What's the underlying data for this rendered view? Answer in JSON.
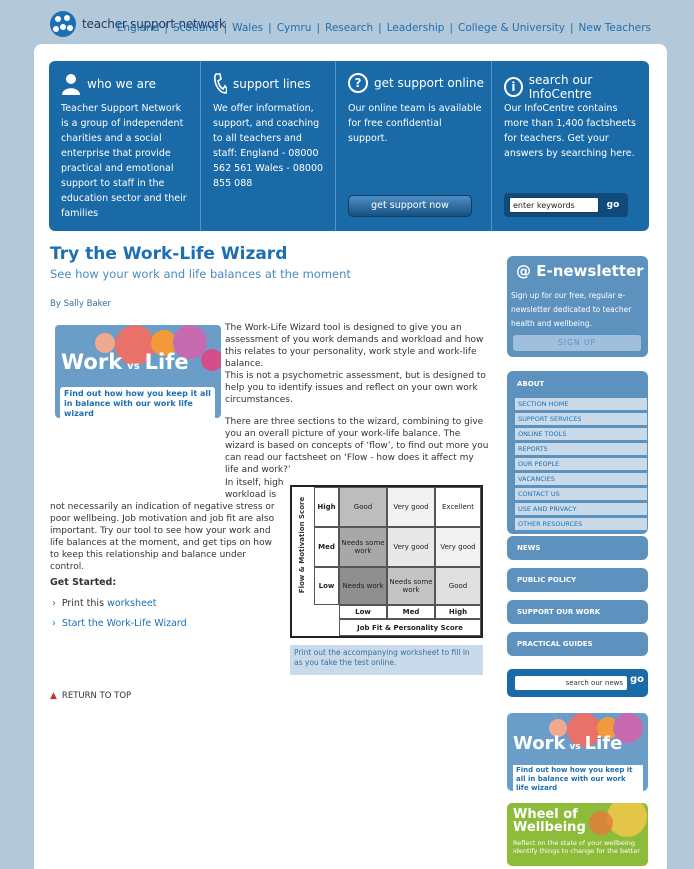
{
  "site": {
    "logo_text": "teacher support network"
  },
  "topnav": [
    "England",
    "Scotland",
    "Wales",
    "Cymru",
    "Research",
    "Leadership",
    "College & University",
    "New Teachers"
  ],
  "banner": {
    "who": {
      "title": "who we are",
      "text": "Teacher Support Network is a group of independent charities and a social enterprise that provide practical and emotional support to staff in the education sector and their families"
    },
    "lines": {
      "title": "support lines",
      "text": "We offer information, support, and coaching to all teachers and staff: England - 08000 562 561 Wales - 08000 855 088"
    },
    "online": {
      "title": "get support online",
      "text": "Our online team is available for free confidential support.",
      "button": "get support now"
    },
    "info": {
      "title": "search our InfoCentre",
      "text": "Our InfoCentre contains more than 1,400 factsheets for teachers. Get your answers by searching here.",
      "search_placeholder": "enter keywords",
      "go": "go"
    }
  },
  "article": {
    "title": "Try the Work-Life Wizard",
    "subtitle": "See how your work and life balances at the moment",
    "byline": "By Sally Baker",
    "hero": {
      "work": "Work",
      "vs": "vs",
      "life": "Life",
      "tagline": "Find out how how you keep it all in balance with our work life wizard"
    },
    "p1": "The Work-Life Wizard tool is designed to give you an assessment of you work demands and workload and how this relates to your personality, work style and work-life balance.",
    "p2": "This is not a psychometric assessment, but is designed to help you to identify issues and reflect on your own work circumstances.",
    "p3": "There are three sections to the wizard, combining to give you an overall picture of your work-life balance. The wizard is based on concepts of ‘flow’, to find out more you can read our factsheet on ‘Flow - how does it affect my life and work?’",
    "p4a": "In itself, high workload is",
    "p4b": "not necessarily an indication of negative stress or poor wellbeing. Job motivation and job fit are also important. Try our tool to see how your work and life balances at the moment, and get tips on how to keep this relationship and balance under control.",
    "get_started": "Get Started:",
    "link1_pre": "Print this ",
    "link1": "worksheet",
    "link2": "Start the Work-Life Wizard",
    "return_top": "RETURN TO TOP"
  },
  "matrix": {
    "y_axis": "Flow & Motivation Score",
    "x_axis": "Job Fit & Personality Score",
    "rows": [
      "High",
      "Med",
      "Low"
    ],
    "cols": [
      "Low",
      "Med",
      "High"
    ],
    "cells": [
      [
        "Good",
        "Very good",
        "Excellent"
      ],
      [
        "Needs some work",
        "Very good",
        "Very good"
      ],
      [
        "Needs work",
        "Needs some work",
        "Good"
      ]
    ],
    "caption": "Print out the accompanying worksheet to fill in as you take the test online."
  },
  "sidebar": {
    "enews": {
      "title": "@ E-newsletter",
      "text": "Sign up for our free, regular e-newsletter dedicated to teacher health and wellbeing.",
      "button": "SIGN UP"
    },
    "about": {
      "title": "ABOUT",
      "items": [
        "SECTION HOME",
        "SUPPORT SERVICES",
        "ONLINE TOOLS",
        "REPORTS",
        "OUR PEOPLE",
        "VACANCIES",
        "CONTACT US",
        "USE AND PRIVACY",
        "OTHER RESOURCES"
      ]
    },
    "sections": [
      "NEWS",
      "PUBLIC POLICY",
      "SUPPORT OUR WORK",
      "PRACTICAL GUIDES"
    ],
    "news_search": {
      "placeholder": "search our news",
      "go": "go"
    },
    "promo1": {
      "work": "Work",
      "vs": "vs",
      "life": "Life",
      "tagline": "Find out how how you keep it all in balance with our work life wizard"
    },
    "promo2": {
      "title": "Wheel of Wellbeing",
      "tagline": "Reflect on the state of your wellbeing identify things to change for the better"
    }
  }
}
